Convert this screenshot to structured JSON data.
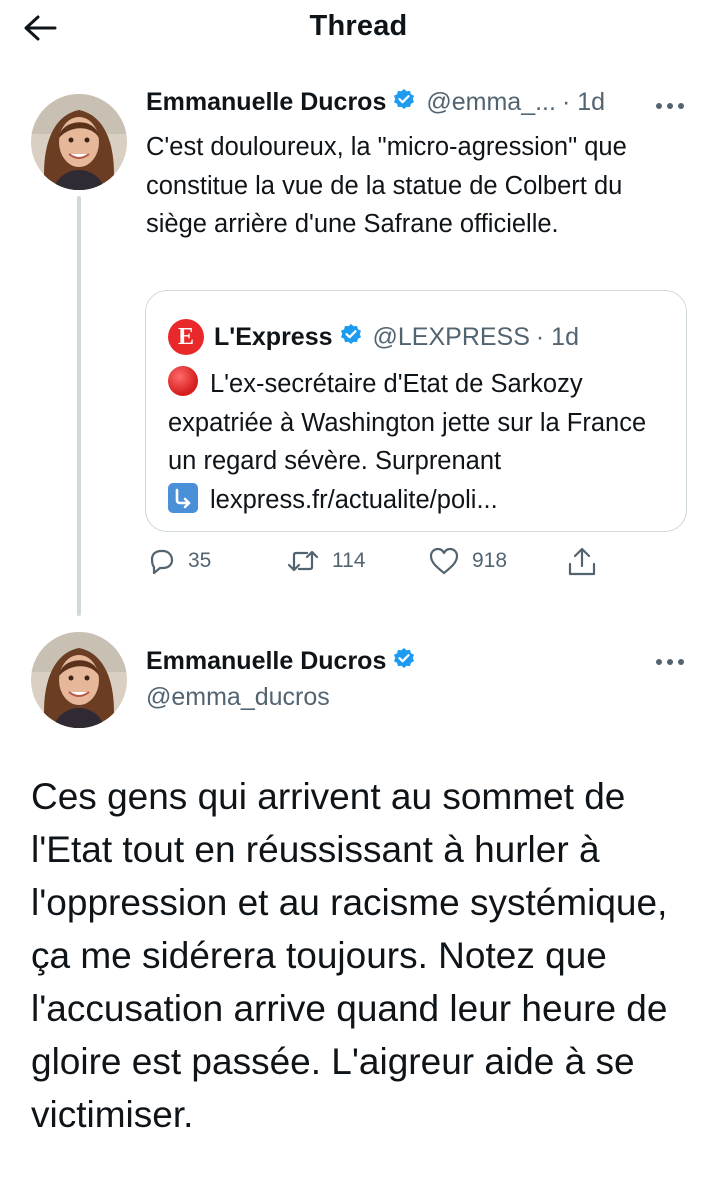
{
  "header": {
    "title": "Thread"
  },
  "tweet1": {
    "name": "Emmanuelle Ducros",
    "handle": "@emma_...",
    "time": "· 1d",
    "text": "C'est douloureux, la \"micro-agression\" que constitue la vue de la statue de Colbert du siège arrière d'une Safrane officielle.",
    "quote": {
      "logo_letter": "E",
      "name": "L'Express",
      "handle": "@LEXPRESS",
      "time": "· 1d",
      "text": "L'ex-secrétaire d'Etat de Sarkozy expatriée à Washington jette sur la France un regard sévère. Surprenant",
      "link": "lexpress.fr/actualite/poli..."
    },
    "actions": {
      "replies": "35",
      "retweets": "114",
      "likes": "918"
    }
  },
  "tweet2": {
    "name": "Emmanuelle Ducros",
    "handle": "@emma_ducros",
    "text": "Ces gens qui arrivent au sommet de l'Etat tout en réussissant à hurler à l'oppression et au racisme systémique, ça me sidérera toujours. Notez que l'accusation arrive quand leur heure de gloire est passée. L'aigreur aide à se victimiser."
  },
  "colors": {
    "verified": "#1d9bf0",
    "secondary_text": "#536471",
    "border": "#cfd9de",
    "express_red": "#e8282b"
  },
  "icons": [
    "back-arrow-icon",
    "verified-badge-icon",
    "more-icon",
    "reply-icon",
    "retweet-icon",
    "like-icon",
    "share-icon",
    "red-circle-emoji",
    "arrow-down-right-emoji"
  ]
}
